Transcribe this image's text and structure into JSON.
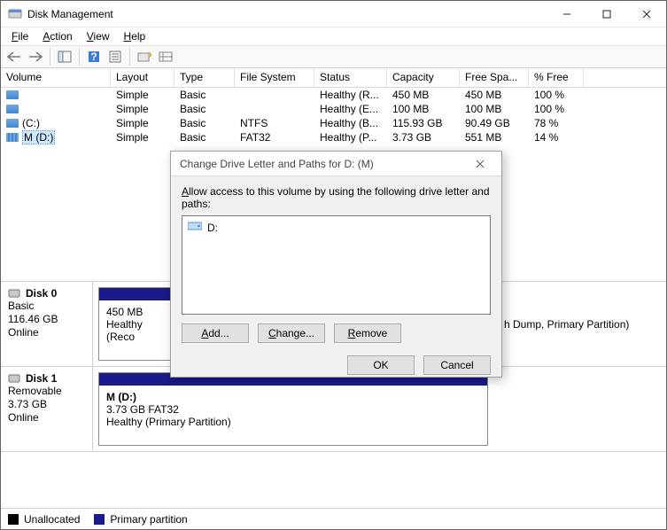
{
  "window": {
    "title": "Disk Management"
  },
  "menu": {
    "file": "File",
    "action": "Action",
    "view": "View",
    "help": "Help"
  },
  "columns": {
    "volume": "Volume",
    "layout": "Layout",
    "type": "Type",
    "filesystem": "File System",
    "status": "Status",
    "capacity": "Capacity",
    "freespace": "Free Spa...",
    "pctfree": "% Free"
  },
  "widths": {
    "volume": 124,
    "layout": 72,
    "type": 68,
    "filesystem": 90,
    "status": 82,
    "capacity": 82,
    "freespace": 78,
    "pctfree": 62
  },
  "rows": [
    {
      "vol": "",
      "icon": "plain",
      "layout": "Simple",
      "type": "Basic",
      "fs": "",
      "status": "Healthy (R...",
      "cap": "450 MB",
      "free": "450 MB",
      "pct": "100 %",
      "sel": false
    },
    {
      "vol": "",
      "icon": "plain",
      "layout": "Simple",
      "type": "Basic",
      "fs": "",
      "status": "Healthy (E...",
      "cap": "100 MB",
      "free": "100 MB",
      "pct": "100 %",
      "sel": false
    },
    {
      "vol": " (C:)",
      "icon": "plain",
      "layout": "Simple",
      "type": "Basic",
      "fs": "NTFS",
      "status": "Healthy (B...",
      "cap": "115.93 GB",
      "free": "90.49 GB",
      "pct": "78 %",
      "sel": false
    },
    {
      "vol": "M (D:)",
      "icon": "stripe",
      "layout": "Simple",
      "type": "Basic",
      "fs": "FAT32",
      "status": "Healthy (P...",
      "cap": "3.73 GB",
      "free": "551 MB",
      "pct": "14 %",
      "sel": true
    }
  ],
  "disk0": {
    "name": "Disk 0",
    "type": "Basic",
    "size": "116.46 GB",
    "status": "Online",
    "part0": {
      "top": "450 MB",
      "bottom": "Healthy (Reco"
    },
    "part_tail": "h Dump, Primary Partition)"
  },
  "disk1": {
    "name": "Disk 1",
    "type": "Removable",
    "size": "3.73 GB",
    "status": "Online",
    "part0": {
      "line1": "M  (D:)",
      "line2": "3.73 GB FAT32",
      "line3": "Healthy (Primary Partition)"
    }
  },
  "legend": {
    "unalloc": "Unallocated",
    "primary": "Primary partition"
  },
  "dialog": {
    "title": "Change Drive Letter and Paths for D: (M)",
    "desc": "Allow access to this volume by using the following drive letter and paths:",
    "item0": "D:",
    "add": "Add...",
    "change": "Change...",
    "remove": "Remove",
    "ok": "OK",
    "cancel": "Cancel"
  }
}
